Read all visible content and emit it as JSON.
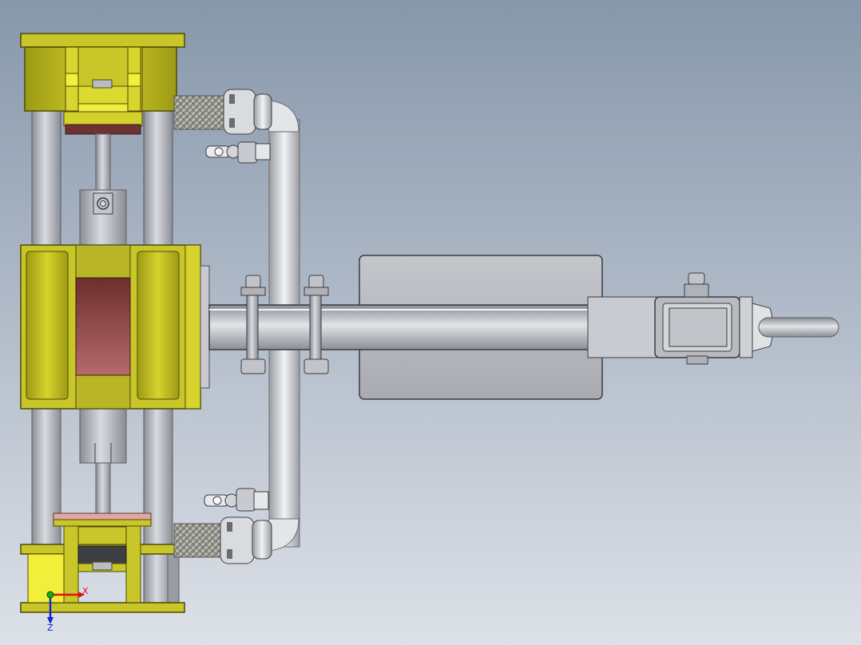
{
  "viewport": {
    "background_top": "#8797ab",
    "background_bottom": "#dde1e8"
  },
  "colors": {
    "yellow": "#c9c62a",
    "yellow_dark": "#8a8a10",
    "yellow_light": "#f2ef3a",
    "steel": "#b9bcc3",
    "steel_dark": "#7e8188",
    "pad": "#8a3a3a",
    "hose": "#8e8f86"
  },
  "triad": {
    "x_label": "X",
    "z_label": "Z",
    "x_color": "#e01010",
    "y_color": "#10b010",
    "z_color": "#1028d0"
  }
}
